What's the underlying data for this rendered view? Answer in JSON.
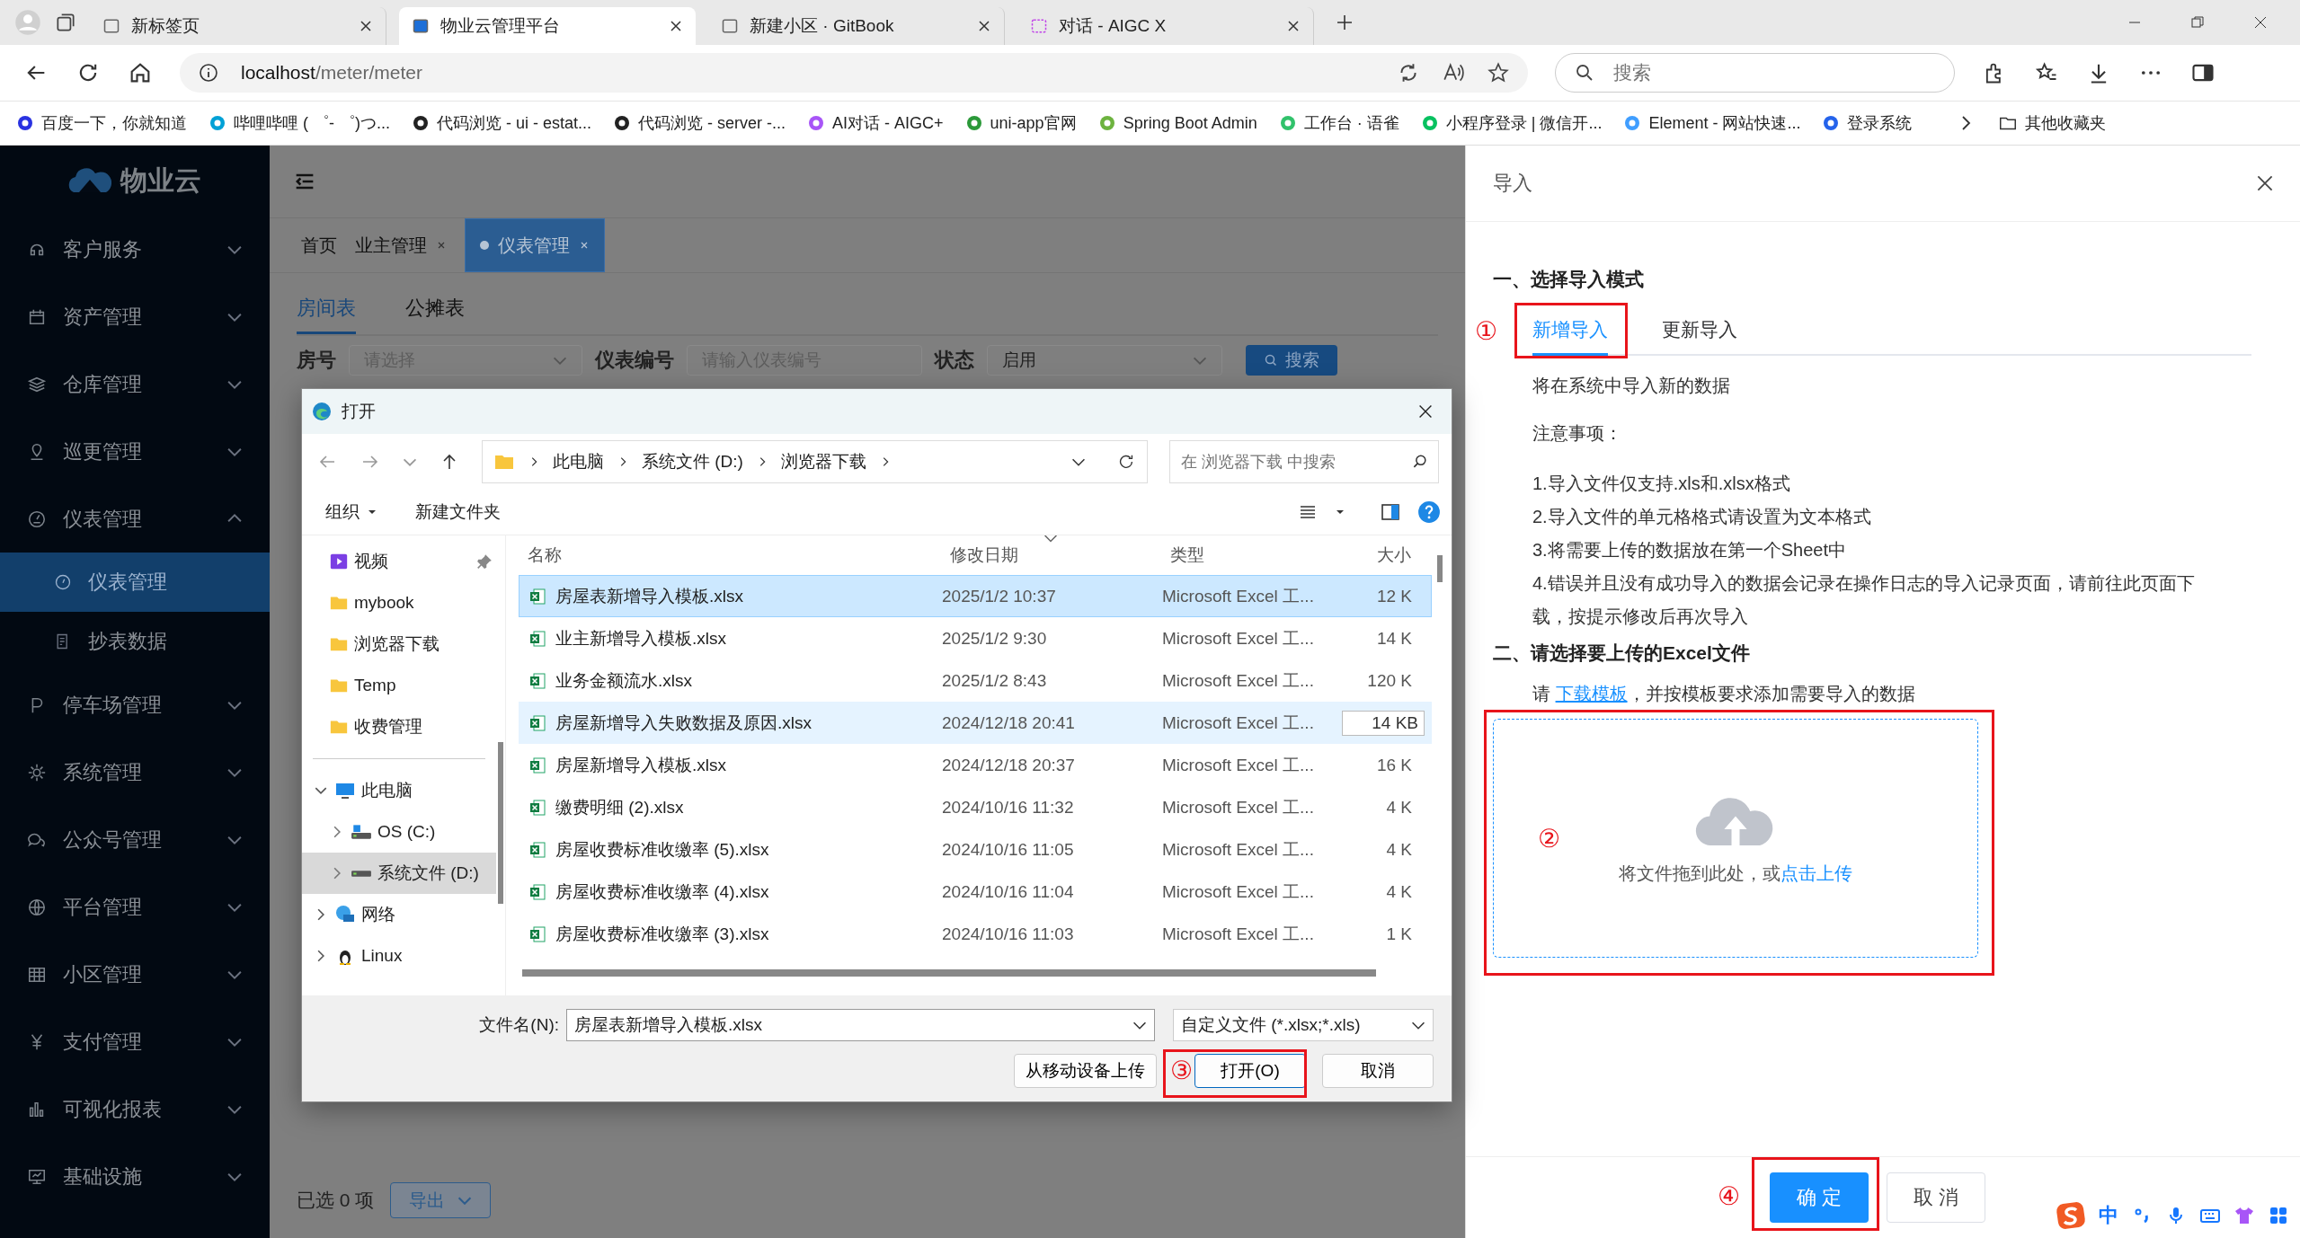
{
  "browser": {
    "tabs": [
      {
        "title": "新标签页",
        "selected": false
      },
      {
        "title": "物业云管理平台",
        "selected": true
      },
      {
        "title": "新建小区 · GitBook",
        "selected": false
      },
      {
        "title": "对话 - AIGC X",
        "selected": false
      }
    ],
    "address": {
      "host": "localhost",
      "path": "/meter/meter"
    },
    "search": {
      "placeholder": "搜索"
    },
    "bookmarks": [
      "百度一下，你就知道",
      "哔哩哔哩 ( ゜- ゜)つ...",
      "代码浏览 - ui - estat...",
      "代码浏览 - server -...",
      "AI对话 - AIGC+",
      "uni-app官网",
      "Spring Boot Admin",
      "工作台 · 语雀",
      "小程序登录 | 微信开...",
      "Element - 网站快速...",
      "登录系统"
    ],
    "other_bookmarks": "其他收藏夹"
  },
  "sidebar": {
    "logo": "物业云",
    "menu": [
      {
        "label": "客户服务",
        "expanded": false
      },
      {
        "label": "资产管理",
        "expanded": false
      },
      {
        "label": "仓库管理",
        "expanded": false
      },
      {
        "label": "巡更管理",
        "expanded": false
      },
      {
        "label": "仪表管理",
        "expanded": true,
        "children": [
          {
            "label": "仪表管理",
            "selected": true
          },
          {
            "label": "抄表数据",
            "selected": false
          }
        ]
      },
      {
        "label": "停车场管理",
        "expanded": false
      },
      {
        "label": "系统管理",
        "expanded": false
      },
      {
        "label": "公众号管理",
        "expanded": false
      },
      {
        "label": "平台管理",
        "expanded": false
      },
      {
        "label": "小区管理",
        "expanded": false
      },
      {
        "label": "支付管理",
        "expanded": false
      },
      {
        "label": "可视化报表",
        "expanded": false
      },
      {
        "label": "基础设施",
        "expanded": false
      }
    ]
  },
  "app_header": {
    "tags": [
      {
        "label": "首页",
        "selected": false,
        "closable": false
      },
      {
        "label": "业主管理",
        "selected": false,
        "closable": true
      },
      {
        "label": "仪表管理",
        "selected": true,
        "closable": true
      }
    ]
  },
  "page": {
    "tabs": [
      {
        "label": "房间表",
        "selected": true
      },
      {
        "label": "公摊表",
        "selected": false
      }
    ],
    "filters": [
      {
        "label": "房号",
        "kind": "select",
        "placeholder": "请选择"
      },
      {
        "label": "仪表编号",
        "kind": "input",
        "placeholder": "请输入仪表编号"
      },
      {
        "label": "状态",
        "kind": "select",
        "value": "启用"
      }
    ],
    "search_button": "搜索",
    "selection": "已选 0 项",
    "export_button": "导出"
  },
  "file_dialog": {
    "title": "打开",
    "path": [
      "此电脑",
      "系统文件 (D:)",
      "浏览器下载"
    ],
    "search": {
      "placeholder": "在 浏览器下载 中搜索"
    },
    "toolbar": [
      "组织",
      "新建文件夹"
    ],
    "quick_access": [
      {
        "label": "视频",
        "kind": "video",
        "pinned": true
      },
      {
        "label": "mybook",
        "kind": "folder",
        "pinned": false
      },
      {
        "label": "浏览器下载",
        "kind": "folder",
        "pinned": false
      },
      {
        "label": "Temp",
        "kind": "folder",
        "pinned": false
      },
      {
        "label": "收费管理",
        "kind": "folder",
        "pinned": false
      }
    ],
    "tree": [
      {
        "label": "此电脑",
        "kind": "computer",
        "expanded": true,
        "selected": false,
        "children": [
          {
            "label": "OS (C:)",
            "kind": "drive",
            "expanded": false,
            "selected": false
          },
          {
            "label": "系统文件 (D:)",
            "kind": "drive",
            "expanded": false,
            "selected": true
          }
        ]
      },
      {
        "label": "网络",
        "kind": "network",
        "expanded": false,
        "selected": false
      },
      {
        "label": "Linux",
        "kind": "linux",
        "expanded": false,
        "selected": false
      }
    ],
    "columns": [
      "名称",
      "修改日期",
      "类型",
      "大小"
    ],
    "files": [
      {
        "name": "房屋表新增导入模板.xlsx",
        "modified": "2025/1/2 10:37",
        "type": "Microsoft Excel 工...",
        "size": "12 K",
        "selected": true,
        "hovered": false
      },
      {
        "name": "业主新增导入模板.xlsx",
        "modified": "2025/1/2 9:30",
        "type": "Microsoft Excel 工...",
        "size": "14 K",
        "selected": false,
        "hovered": false
      },
      {
        "name": "业务金额流水.xlsx",
        "modified": "2025/1/2 8:43",
        "type": "Microsoft Excel 工...",
        "size": "120 K",
        "selected": false,
        "hovered": false
      },
      {
        "name": "房屋新增导入失败数据及原因.xlsx",
        "modified": "2024/12/18 20:41",
        "type": "Microsoft Excel 工...",
        "size": "14 KB",
        "selected": false,
        "hovered": true
      },
      {
        "name": "房屋新增导入模板.xlsx",
        "modified": "2024/12/18 20:37",
        "type": "Microsoft Excel 工...",
        "size": "16 K",
        "selected": false,
        "hovered": false
      },
      {
        "name": "缴费明细 (2).xlsx",
        "modified": "2024/10/16 11:32",
        "type": "Microsoft Excel 工...",
        "size": "4 K",
        "selected": false,
        "hovered": false
      },
      {
        "name": "房屋收费标准收缴率 (5).xlsx",
        "modified": "2024/10/16 11:05",
        "type": "Microsoft Excel 工...",
        "size": "4 K",
        "selected": false,
        "hovered": false
      },
      {
        "name": "房屋收费标准收缴率 (4).xlsx",
        "modified": "2024/10/16 11:04",
        "type": "Microsoft Excel 工...",
        "size": "4 K",
        "selected": false,
        "hovered": false
      },
      {
        "name": "房屋收费标准收缴率 (3).xlsx",
        "modified": "2024/10/16 11:03",
        "type": "Microsoft Excel 工...",
        "size": "1 K",
        "selected": false,
        "hovered": false
      }
    ],
    "file_name_label": "文件名(N):",
    "file_name": "房屋表新增导入模板.xlsx",
    "file_type": "自定义文件 (*.xlsx;*.xls)",
    "buttons": [
      {
        "label": "从移动设备上传",
        "kind": "default"
      },
      {
        "label": "打开(O)",
        "kind": "primary"
      },
      {
        "label": "取消",
        "kind": "default"
      }
    ]
  },
  "import_drawer": {
    "title": "导入",
    "section_1": "一、选择导入模式",
    "tabs": [
      {
        "label": "新增导入",
        "selected": true
      },
      {
        "label": "更新导入",
        "selected": false
      }
    ],
    "mode_description": "将在系统中导入新的数据",
    "notes_title": "注意事项：",
    "notes": [
      "1.导入文件仅支持.xls和.xlsx格式",
      "2.导入文件的单元格格式请设置为文本格式",
      "3.将需要上传的数据放在第一个Sheet中",
      "4.错误并且没有成功导入的数据会记录在操作日志的导入记录页面，请前往此页面下载，按提示修改后再次导入"
    ],
    "section_2": "二、请选择要上传的Excel文件",
    "template_hint": {
      "before": "请 ",
      "link": "下载模板",
      "after": "，并按模板要求添加需要导入的数据"
    },
    "upload": {
      "text": "将文件拖到此处，或",
      "link": "点击上传"
    },
    "confirm_button": "确 定",
    "cancel_button": "取 消"
  },
  "annotations": [
    "①",
    "②",
    "③",
    "④"
  ],
  "ime": {
    "label": "中"
  }
}
